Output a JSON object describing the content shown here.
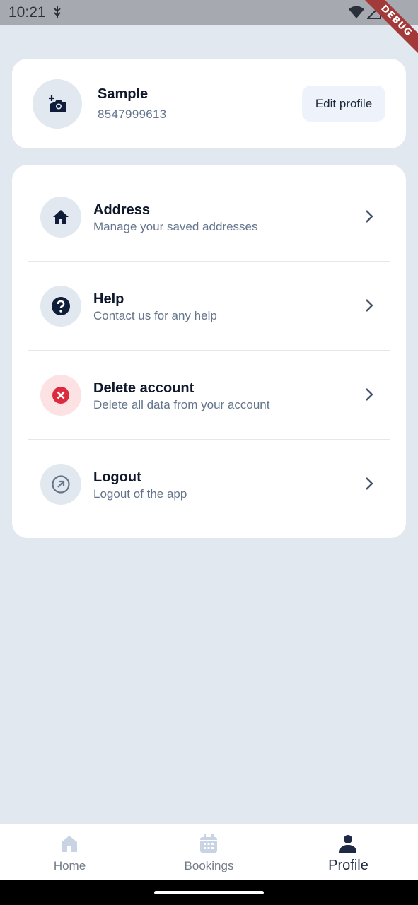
{
  "status_bar": {
    "time": "10:21",
    "debug_label": "DEBUG"
  },
  "profile": {
    "name": "Sample",
    "phone": "8547999613",
    "edit_label": "Edit profile",
    "avatar_icon": "add-photo-icon"
  },
  "menu": {
    "items": [
      {
        "title": "Address",
        "subtitle": "Manage your saved addresses",
        "icon": "home-icon",
        "icon_bg": "#e2e8f0",
        "icon_color": "#0f1d3a"
      },
      {
        "title": "Help",
        "subtitle": "Contact us for any help",
        "icon": "help-icon",
        "icon_bg": "#e2e8f0",
        "icon_color": "#0f1d3a"
      },
      {
        "title": "Delete account",
        "subtitle": "Delete all data from your account",
        "icon": "cancel-icon",
        "icon_bg": "#fde2e4",
        "icon_color": "#dc2b3e"
      },
      {
        "title": "Logout",
        "subtitle": "Logout of the app",
        "icon": "logout-icon",
        "icon_bg": "#e2e8f0",
        "icon_color": "#64748b"
      }
    ]
  },
  "bottom_nav": {
    "items": [
      {
        "label": "Home",
        "icon": "home-icon",
        "active": false
      },
      {
        "label": "Bookings",
        "icon": "calendar-icon",
        "active": false
      },
      {
        "label": "Profile",
        "icon": "person-icon",
        "active": true
      }
    ]
  },
  "colors": {
    "background": "#e2e8f0",
    "card": "#ffffff",
    "primary_text": "#0f172a",
    "secondary_text": "#64748b",
    "active_nav": "#1e2a44",
    "inactive_nav": "#9ca3af"
  }
}
